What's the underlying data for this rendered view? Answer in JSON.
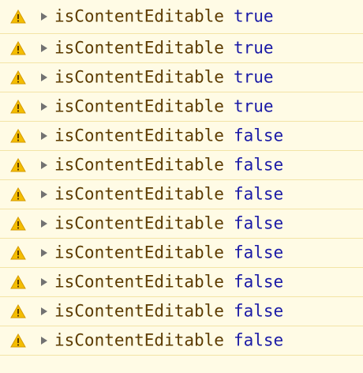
{
  "console": {
    "entries": [
      {
        "key": "isContentEditable",
        "value": "true"
      },
      {
        "key": "isContentEditable",
        "value": "true"
      },
      {
        "key": "isContentEditable",
        "value": "true"
      },
      {
        "key": "isContentEditable",
        "value": "true"
      },
      {
        "key": "isContentEditable",
        "value": "false"
      },
      {
        "key": "isContentEditable",
        "value": "false"
      },
      {
        "key": "isContentEditable",
        "value": "false"
      },
      {
        "key": "isContentEditable",
        "value": "false"
      },
      {
        "key": "isContentEditable",
        "value": "false"
      },
      {
        "key": "isContentEditable",
        "value": "false"
      },
      {
        "key": "isContentEditable",
        "value": "false"
      },
      {
        "key": "isContentEditable",
        "value": "false"
      }
    ],
    "row_icon": "warning-icon",
    "expand_icon": "disclosure-triangle-icon",
    "colors": {
      "background": "#fffbe5",
      "separator": "#f3e4a6",
      "key_text": "#5c3b00",
      "value_text": "#1a1aa6",
      "warning_fill": "#f4bd00"
    }
  }
}
